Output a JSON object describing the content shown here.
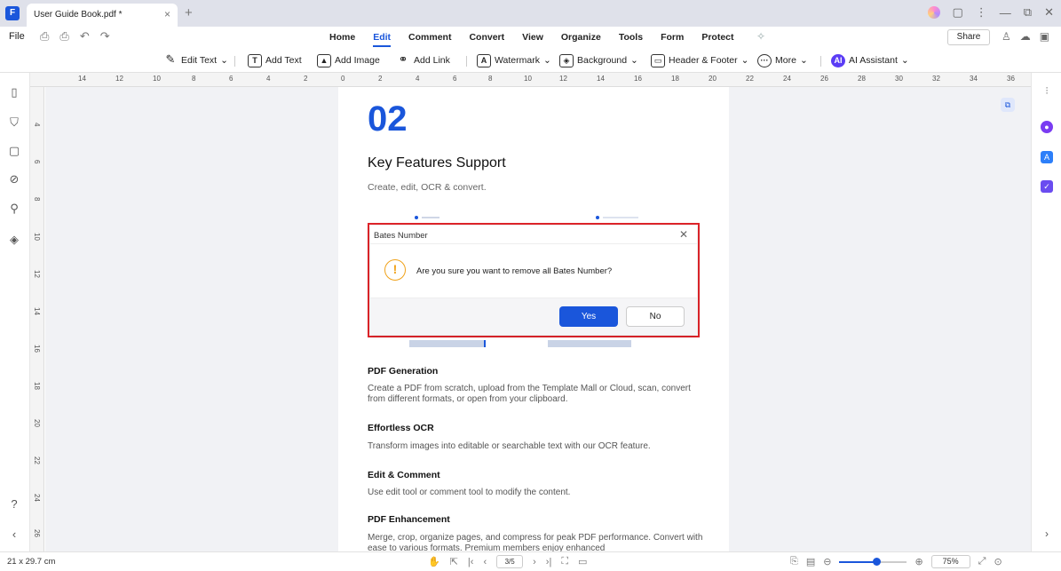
{
  "titlebar": {
    "logo": "F",
    "doc_tab_title": "User Guide Book.pdf *",
    "close_glyph": "×",
    "new_tab_glyph": "+",
    "window_controls": [
      "▢",
      "⋮",
      "—",
      "⧉",
      "✕"
    ]
  },
  "menubar": {
    "file_label": "File",
    "quick_icons": [
      "⎙",
      "⎙",
      "↶",
      "↷"
    ],
    "tabs": [
      {
        "label": "Home",
        "active": false
      },
      {
        "label": "Edit",
        "active": true
      },
      {
        "label": "Comment",
        "active": false
      },
      {
        "label": "Convert",
        "active": false
      },
      {
        "label": "View",
        "active": false
      },
      {
        "label": "Organize",
        "active": false
      },
      {
        "label": "Tools",
        "active": false
      },
      {
        "label": "Form",
        "active": false
      },
      {
        "label": "Protect",
        "active": false
      }
    ],
    "share_label": "Share"
  },
  "toolbar": {
    "edit_text": "Edit Text",
    "add_text": "Add Text",
    "add_image": "Add Image",
    "add_link": "Add Link",
    "watermark": "Watermark",
    "background": "Background",
    "header_footer": "Header & Footer",
    "more": "More",
    "ai_assistant": "AI Assistant"
  },
  "ruler": {
    "top_ticks": [
      "14",
      "12",
      "10",
      "8",
      "6",
      "4",
      "2",
      "0",
      "2",
      "4",
      "6",
      "8",
      "10",
      "12",
      "14",
      "16",
      "18",
      "20",
      "22",
      "24",
      "26",
      "28",
      "30",
      "32",
      "34",
      "36"
    ],
    "left_ticks": [
      "4",
      "6",
      "8",
      "10",
      "12",
      "14",
      "16",
      "18",
      "20",
      "22",
      "24",
      "26"
    ]
  },
  "page": {
    "number": "02",
    "heading": "Key Features Support",
    "subheading": "Create, edit, OCR & convert.",
    "sections": [
      {
        "title": "PDF Generation",
        "body": "Create a PDF from scratch, upload from the Template Mall or Cloud, scan, convert from different formats, or open from your clipboard."
      },
      {
        "title": "Effortless OCR",
        "body": "Transform images into editable or searchable text with our OCR feature."
      },
      {
        "title": "Edit & Comment",
        "body": "Use edit tool or comment tool to modify the content."
      },
      {
        "title": "PDF Enhancement",
        "body": "Merge, crop, organize pages, and compress for peak PDF performance. Convert with ease to various formats. Premium members enjoy enhanced"
      }
    ]
  },
  "dialog": {
    "title": "Bates Number",
    "message": "Are you sure you want to remove all Bates Number?",
    "warning_glyph": "!",
    "yes_label": "Yes",
    "no_label": "No",
    "close_glyph": "✕"
  },
  "statusbar": {
    "page_size": "21 x 29.7 cm",
    "page_indicator": "3/5",
    "zoom": "75%",
    "zoom_level": 0.55
  },
  "colors": {
    "accent": "#1a56db",
    "highlight": "#e0242a",
    "warning": "#f0a21a"
  }
}
